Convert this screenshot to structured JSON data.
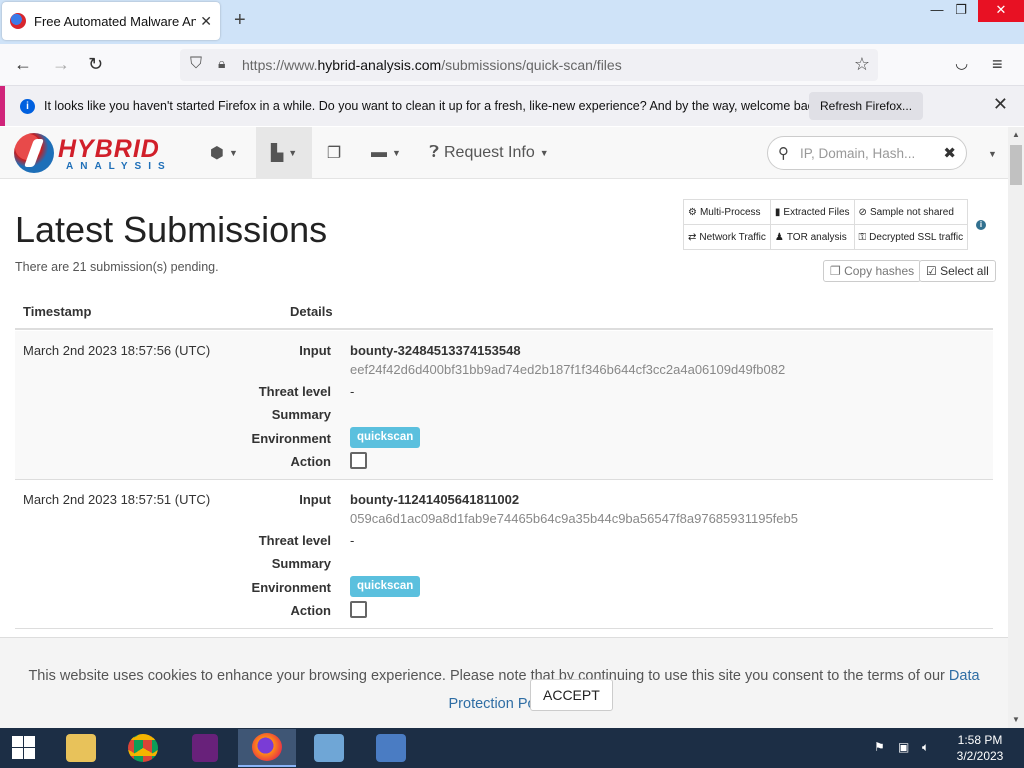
{
  "browser": {
    "tab_title": "Free Automated Malware Analy",
    "url_prefix": "https://www.",
    "url_domain": "hybrid-analysis.com",
    "url_path": "/submissions/quick-scan/files"
  },
  "notification": {
    "message": "It looks like you haven't started Firefox in a while. Do you want to clean it up for a fresh, like-new experience? And by the way, welcome back!",
    "button": "Refresh Firefox..."
  },
  "site": {
    "logo_top": "HYBRID",
    "logo_bottom": "ANALYSIS",
    "nav_request_info": "Request Info",
    "search_placeholder": "IP, Domain, Hash..."
  },
  "page": {
    "title": "Latest Submissions",
    "pending": "There are 21 submission(s) pending.",
    "copy_hashes": "Copy hashes",
    "select_all": "Select all"
  },
  "legend": {
    "multi_process": "Multi-Process",
    "extracted_files": "Extracted Files",
    "sample_not_shared": "Sample not shared",
    "network_traffic": "Network Traffic",
    "tor_analysis": "TOR analysis",
    "decrypted_ssl": "Decrypted SSL traffic"
  },
  "table": {
    "col_timestamp": "Timestamp",
    "col_details": "Details",
    "labels": {
      "input": "Input",
      "threat_level": "Threat level",
      "summary": "Summary",
      "environment": "Environment",
      "action": "Action"
    },
    "rows": [
      {
        "timestamp": "March 2nd 2023 18:57:56 (UTC)",
        "name": "bounty-32484513374153548",
        "hash": "eef24f42d6d400bf31bb9ad74ed2b187f1f346b644cf3cc2a4a06109d49fb082",
        "threat_level": "-",
        "environment": "quickscan"
      },
      {
        "timestamp": "March 2nd 2023 18:57:51 (UTC)",
        "name": "bounty-11241405641811002",
        "hash": "059ca6d1ac09a8d1fab9e74465b64c9a35b44c9ba56547f8a97685931195feb5",
        "threat_level": "-",
        "environment": "quickscan"
      }
    ]
  },
  "cookie": {
    "text": "This website uses cookies to enhance your browsing experience. Please note that by continuing to use this site you consent to the terms of our",
    "link": "Data Protection Policy.",
    "accept": "ACCEPT"
  },
  "taskbar": {
    "time": "1:58 PM",
    "date": "3/2/2023"
  },
  "colors": {
    "brand_red": "#d11f2a",
    "brand_blue": "#1e6fb8",
    "badge": "#5bc0de",
    "taskbar": "#1c2e45"
  }
}
